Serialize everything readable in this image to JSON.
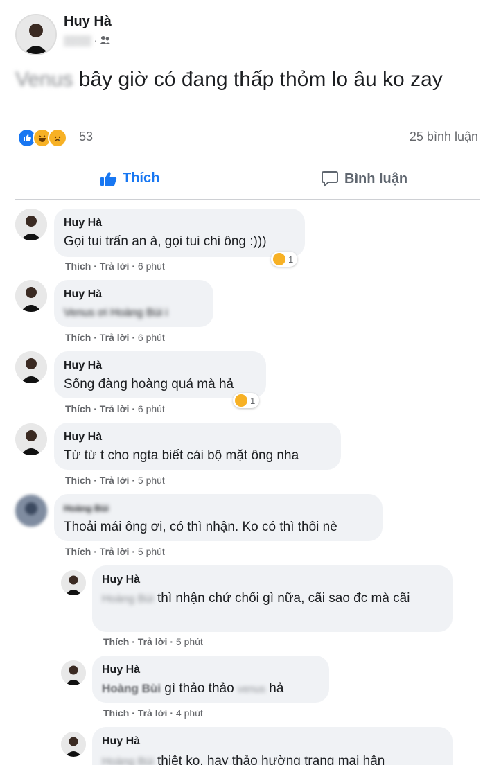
{
  "post": {
    "author": "Huy Hà",
    "text_blurred": "Venus",
    "text": "bây giờ có đang thấp thỏm lo âu ko zay",
    "reaction_count": "53",
    "comment_count": "25 bình luận",
    "like_label": "Thích",
    "comment_label": "Bình luận"
  },
  "comment_actions": {
    "like": "Thích",
    "sep": "·",
    "reply": "Trả lời"
  },
  "comments": [
    {
      "author": "Huy Hà",
      "text": "Gọi tui trấn an à, gọi tui chi ông :)))",
      "time": "6 phút",
      "reaction": "1"
    },
    {
      "author": "Huy Hà",
      "text_blurred": "Venus ơi Hoàng Bùi i",
      "time": "6 phút"
    },
    {
      "author": "Huy Hà",
      "text": "Sống đàng hoàng quá mà hả",
      "time": "6 phút",
      "reaction": "1"
    },
    {
      "author": "Huy Hà",
      "text": "Từ từ t cho ngta biết cái bộ mặt ông nha",
      "time": "5 phút"
    },
    {
      "author_blurred": "Hoàng Bùi",
      "text": "Thoải mái ông ơi, có thì nhận. Ko có thì thôi nè",
      "time": "5 phút"
    }
  ],
  "replies": [
    {
      "author": "Huy Hà",
      "mention_blurred": "Hoàng Bùi",
      "text": "thì nhận chứ chối gì nữa, cãi sao đc mà cãi",
      "time": "5 phút"
    },
    {
      "author": "Huy Hà",
      "mention": "Hoàng Bùi",
      "text": "gì thảo thảo",
      "blurred": "venus",
      "text_end": "hả",
      "time": "4 phút"
    },
    {
      "author": "Huy Hà",
      "mention_blurred": "Hoàng Bùi",
      "text": "thiệt ko, hay thảo hường trang mai hân"
    }
  ],
  "colors": {
    "facebook_blue": "#1877f2",
    "secondary_text": "#65676b",
    "bubble_bg": "#f0f2f5"
  }
}
